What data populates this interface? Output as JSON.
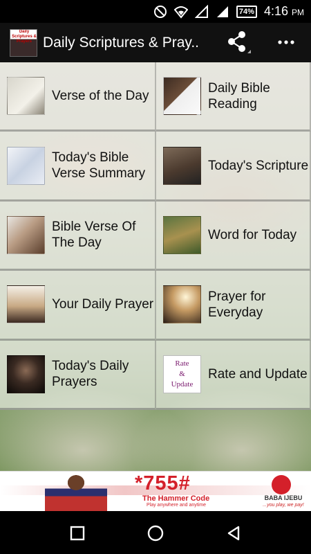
{
  "status_bar": {
    "battery": "74%",
    "time": "4:16",
    "ampm": "PM",
    "icons": [
      "dnd-icon",
      "wifi-icon",
      "signal-icon",
      "battery-icon"
    ]
  },
  "app_bar": {
    "title": "Daily Scriptures & Pray..",
    "logo_text": "Daily Scriptures & Prayers",
    "actions": [
      "share-icon",
      "overflow-menu-icon"
    ]
  },
  "menu": {
    "items": [
      {
        "label": "Verse of the Day",
        "icon": "coffee-bible-thumb"
      },
      {
        "label": "Daily Bible Reading",
        "icon": "woman-reading-thumb"
      },
      {
        "label": "Today's Bible Verse Summary",
        "icon": "hand-on-bible-thumb"
      },
      {
        "label": "Today's Scripture",
        "icon": "woman-with-bible-thumb"
      },
      {
        "label": "Bible Verse Of The Day",
        "icon": "praying-hands-thumb"
      },
      {
        "label": "Word for Today",
        "icon": "girl-reading-grass-thumb"
      },
      {
        "label": "Your Daily Prayer",
        "icon": "kneeling-prayer-thumb"
      },
      {
        "label": "Prayer for Everyday",
        "icon": "praying-woman-light-thumb"
      },
      {
        "label": "Today's Daily Prayers",
        "icon": "woman-praying-up-thumb"
      },
      {
        "label": "Rate and Update",
        "icon": "rate-update-thumb",
        "thumb_lines": [
          "Rate",
          "&",
          "Update"
        ]
      }
    ]
  },
  "ad_banner": {
    "code": "*755#",
    "headline": "The Hammer Code",
    "subline": "Play anywhere and anytime",
    "brand": "BABA IJEBU",
    "tagline": "...you play, we pay!"
  },
  "colors": {
    "status_bar_bg": "#000000",
    "app_bar_bg": "#111111",
    "ad_red": "#d4202a",
    "rate_text": "#7a1a6e"
  }
}
